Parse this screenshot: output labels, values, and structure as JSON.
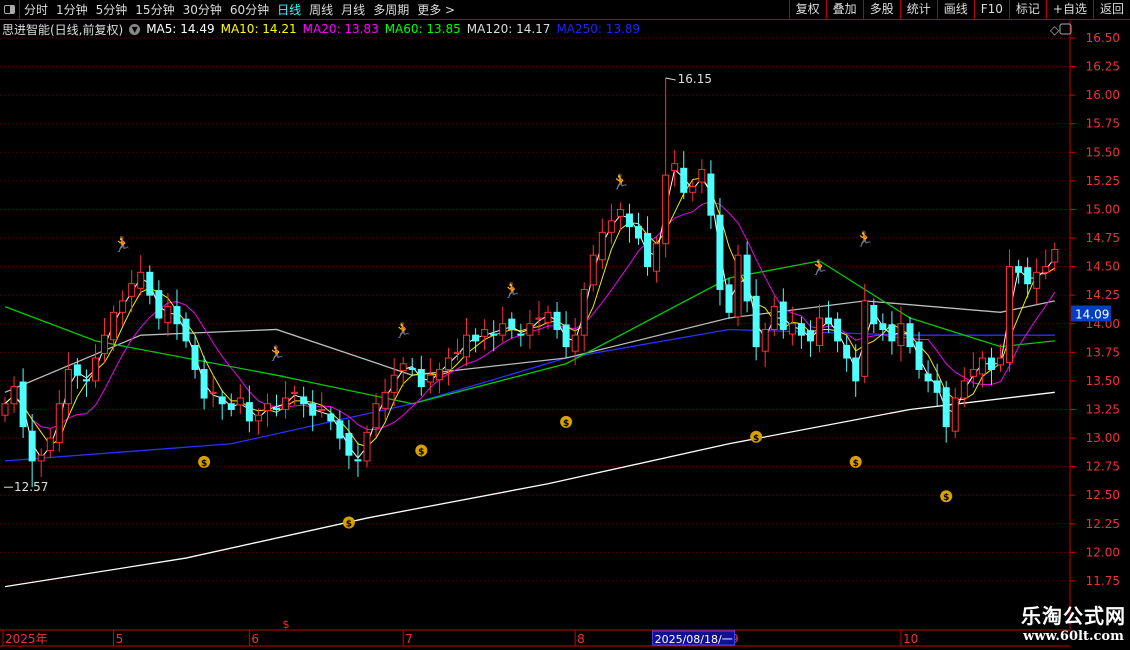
{
  "toolbar": {
    "tabs": [
      "分时",
      "1分钟",
      "5分钟",
      "15分钟",
      "30分钟",
      "60分钟",
      "日线",
      "周线",
      "月线",
      "多周期",
      "更多 >"
    ],
    "active": 6,
    "right_buttons": [
      "复权",
      "叠加",
      "多股",
      "统计",
      "画线",
      "F10",
      "标记",
      "+自选",
      "返回"
    ]
  },
  "info": {
    "title": "思进智能(日线,前复权)",
    "ma": [
      {
        "label": "MA5: 14.49",
        "color": "#ffffff"
      },
      {
        "label": "MA10: 14.21",
        "color": "#ffff00"
      },
      {
        "label": "MA20: 13.83",
        "color": "#ff00ff"
      },
      {
        "label": "MA60: 13.85",
        "color": "#00ff00"
      },
      {
        "label": "MA120: 14.17",
        "color": "#dddddd"
      },
      {
        "label": "MA250: 13.89",
        "color": "#2020ff"
      }
    ]
  },
  "watermark": {
    "name": "乐淘公式网",
    "url": "www.60lt.com"
  },
  "chart_data": {
    "type": "candlestick",
    "ylim": [
      11.6,
      16.6
    ],
    "yticks": [
      "16.50",
      "16.25",
      "16.00",
      "15.75",
      "15.50",
      "15.25",
      "15.00",
      "14.75",
      "14.50",
      "14.25",
      "14.00",
      "13.75",
      "13.50",
      "13.25",
      "13.00",
      "12.75",
      "12.50",
      "12.25",
      "12.00",
      "11.75"
    ],
    "last_price": "14.09",
    "high_label": {
      "text": "16.15",
      "index": 73,
      "price": 16.15
    },
    "low_label": {
      "text": "12.57",
      "index": 3,
      "price": 12.57
    },
    "xlabels": [
      {
        "text": "2025年",
        "index": 0
      },
      {
        "text": "5",
        "index": 12
      },
      {
        "text": "6",
        "index": 27
      },
      {
        "text": "7",
        "index": 44
      },
      {
        "text": "8",
        "index": 63
      },
      {
        "text": "9",
        "index": 80
      },
      {
        "text": "10",
        "index": 99
      }
    ],
    "cursor_label": {
      "text": "2025/08/18/一",
      "index": 72
    },
    "close": [
      13.3,
      13.45,
      13.1,
      12.8,
      12.85,
      13.0,
      13.3,
      13.6,
      13.55,
      13.5,
      13.7,
      13.9,
      14.1,
      14.2,
      14.35,
      14.45,
      14.25,
      14.05,
      14.15,
      14.0,
      13.85,
      13.6,
      13.35,
      13.4,
      13.3,
      13.25,
      13.35,
      13.15,
      13.2,
      13.3,
      13.25,
      13.35,
      13.4,
      13.3,
      13.2,
      13.25,
      13.15,
      13.0,
      12.85,
      12.8,
      13.05,
      13.3,
      13.4,
      13.55,
      13.65,
      13.6,
      13.45,
      13.55,
      13.6,
      13.7,
      13.75,
      13.9,
      13.85,
      13.95,
      13.9,
      14.0,
      13.95,
      13.9,
      14.0,
      14.05,
      14.1,
      13.95,
      13.8,
      13.9,
      14.3,
      14.6,
      14.8,
      14.9,
      15.0,
      14.85,
      14.75,
      14.5,
      14.7,
      15.3,
      15.4,
      15.15,
      15.2,
      15.35,
      14.95,
      14.3,
      14.1,
      14.6,
      14.2,
      13.8,
      13.95,
      14.15,
      13.95,
      14.0,
      13.9,
      13.85,
      14.05,
      14.0,
      13.85,
      13.7,
      13.5,
      14.2,
      14.0,
      13.95,
      13.85,
      14.0,
      13.8,
      13.6,
      13.5,
      13.4,
      13.1,
      13.35,
      13.5,
      13.6,
      13.7,
      13.6,
      13.7,
      14.5,
      14.45,
      14.35,
      14.45,
      14.5,
      14.65
    ],
    "ma60": [
      [
        0,
        14.15
      ],
      [
        10,
        13.85
      ],
      [
        30,
        13.55
      ],
      [
        45,
        13.3
      ],
      [
        62,
        13.65
      ],
      [
        80,
        14.4
      ],
      [
        90,
        14.55
      ],
      [
        100,
        14.05
      ],
      [
        110,
        13.8
      ],
      [
        116,
        13.85
      ]
    ],
    "ma120": [
      [
        0,
        13.4
      ],
      [
        15,
        13.9
      ],
      [
        30,
        13.95
      ],
      [
        45,
        13.55
      ],
      [
        62,
        13.7
      ],
      [
        80,
        14.05
      ],
      [
        95,
        14.2
      ],
      [
        110,
        14.1
      ],
      [
        116,
        14.2
      ]
    ],
    "ma250": [
      [
        0,
        12.8
      ],
      [
        25,
        12.95
      ],
      [
        45,
        13.3
      ],
      [
        62,
        13.7
      ],
      [
        80,
        13.95
      ],
      [
        100,
        13.9
      ],
      [
        116,
        13.9
      ]
    ],
    "ma_white_long": [
      [
        0,
        11.7
      ],
      [
        20,
        11.95
      ],
      [
        40,
        12.3
      ],
      [
        60,
        12.6
      ],
      [
        80,
        12.95
      ],
      [
        100,
        13.25
      ],
      [
        116,
        13.4
      ]
    ],
    "signals": [
      {
        "type": "buy",
        "index": 13,
        "price": 14.7
      },
      {
        "type": "buy",
        "index": 30,
        "price": 13.75
      },
      {
        "type": "buy",
        "index": 44,
        "price": 13.95
      },
      {
        "type": "buy",
        "index": 56,
        "price": 14.3
      },
      {
        "type": "buy",
        "index": 68,
        "price": 15.25
      },
      {
        "type": "buy",
        "index": 90,
        "price": 14.5
      },
      {
        "type": "buy",
        "index": 95,
        "price": 14.75
      },
      {
        "type": "sell",
        "index": 22,
        "price": 12.8
      },
      {
        "type": "sell",
        "index": 38,
        "price": 12.27
      },
      {
        "type": "sell",
        "index": 46,
        "price": 12.9
      },
      {
        "type": "sell",
        "index": 62,
        "price": 13.15
      },
      {
        "type": "sell",
        "index": 83,
        "price": 13.02
      },
      {
        "type": "sell",
        "index": 94,
        "price": 12.8
      },
      {
        "type": "sell",
        "index": 104,
        "price": 12.5
      }
    ]
  }
}
